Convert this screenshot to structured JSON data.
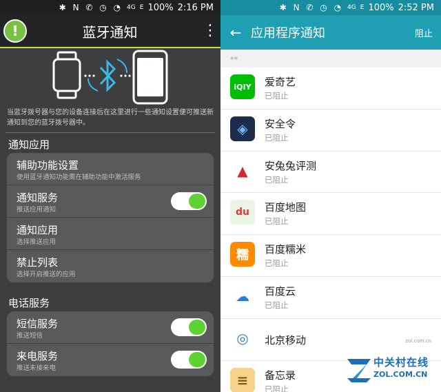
{
  "left": {
    "status": {
      "battery": "100%",
      "time": "2:16 PM",
      "network": "4G",
      "signal_e": "E"
    },
    "appbar": {
      "title": "蓝牙通知",
      "logo_glyph": "!"
    },
    "hero_description": "当蓝牙拨号器与您的设备连接后在这里进行一些通知设置便可推送新通知到您的蓝牙拨号器中。",
    "sections": [
      {
        "title": "通知应用",
        "rows": [
          {
            "title": "辅助功能设置",
            "subtitle": "使用蓝牙通知功能需在辅助功能中激活服务",
            "toggle": false
          },
          {
            "title": "通知服务",
            "subtitle": "推送应用通知",
            "toggle": true
          },
          {
            "title": "通知应用",
            "subtitle": "选择推送应用",
            "toggle": false
          },
          {
            "title": "禁止列表",
            "subtitle": "选择开启推送的应用",
            "toggle": false
          }
        ]
      },
      {
        "title": "电话服务",
        "rows": [
          {
            "title": "短信服务",
            "subtitle": "推送短信",
            "toggle": true
          },
          {
            "title": "来电服务",
            "subtitle": "推送未接来电",
            "toggle": true
          }
        ]
      }
    ]
  },
  "right": {
    "status": {
      "battery": "100%",
      "time": "2:52 PM",
      "network": "4G",
      "signal_e": "E"
    },
    "appbar": {
      "title": "应用程序通知",
      "action": "阻止"
    },
    "subhead": "**",
    "apps": [
      {
        "name": "爱奇艺",
        "state": "已阻止",
        "icon": "iqiyi-icon",
        "color": "#00be06",
        "glyph": "iQIY"
      },
      {
        "name": "安全令",
        "state": "已阻止",
        "icon": "shield-token-icon",
        "color": "#1c2c4a",
        "glyph": "◈"
      },
      {
        "name": "安兔兔评测",
        "state": "已阻止",
        "icon": "antutu-icon",
        "color": "#ffffff",
        "glyph": "▲"
      },
      {
        "name": "百度地图",
        "state": "已阻止",
        "icon": "baidu-map-icon",
        "color": "#e9f4e2",
        "glyph": "du"
      },
      {
        "name": "百度糯米",
        "state": "已阻止",
        "icon": "baidu-nuomi-icon",
        "color": "#ff8a00",
        "glyph": "糯"
      },
      {
        "name": "百度云",
        "state": "已阻止",
        "icon": "baidu-cloud-icon",
        "color": "#ffffff",
        "glyph": "☁"
      },
      {
        "name": "北京移动",
        "state": "",
        "icon": "china-mobile-icon",
        "color": "#ffffff",
        "glyph": "◎"
      },
      {
        "name": "备忘录",
        "state": "已阻止",
        "icon": "memo-icon",
        "color": "#f6d28a",
        "glyph": "≡"
      }
    ]
  },
  "watermark": {
    "cn": "中关村在线",
    "en": "ZOL.COM.CN",
    "small": "zol.com.cn"
  }
}
